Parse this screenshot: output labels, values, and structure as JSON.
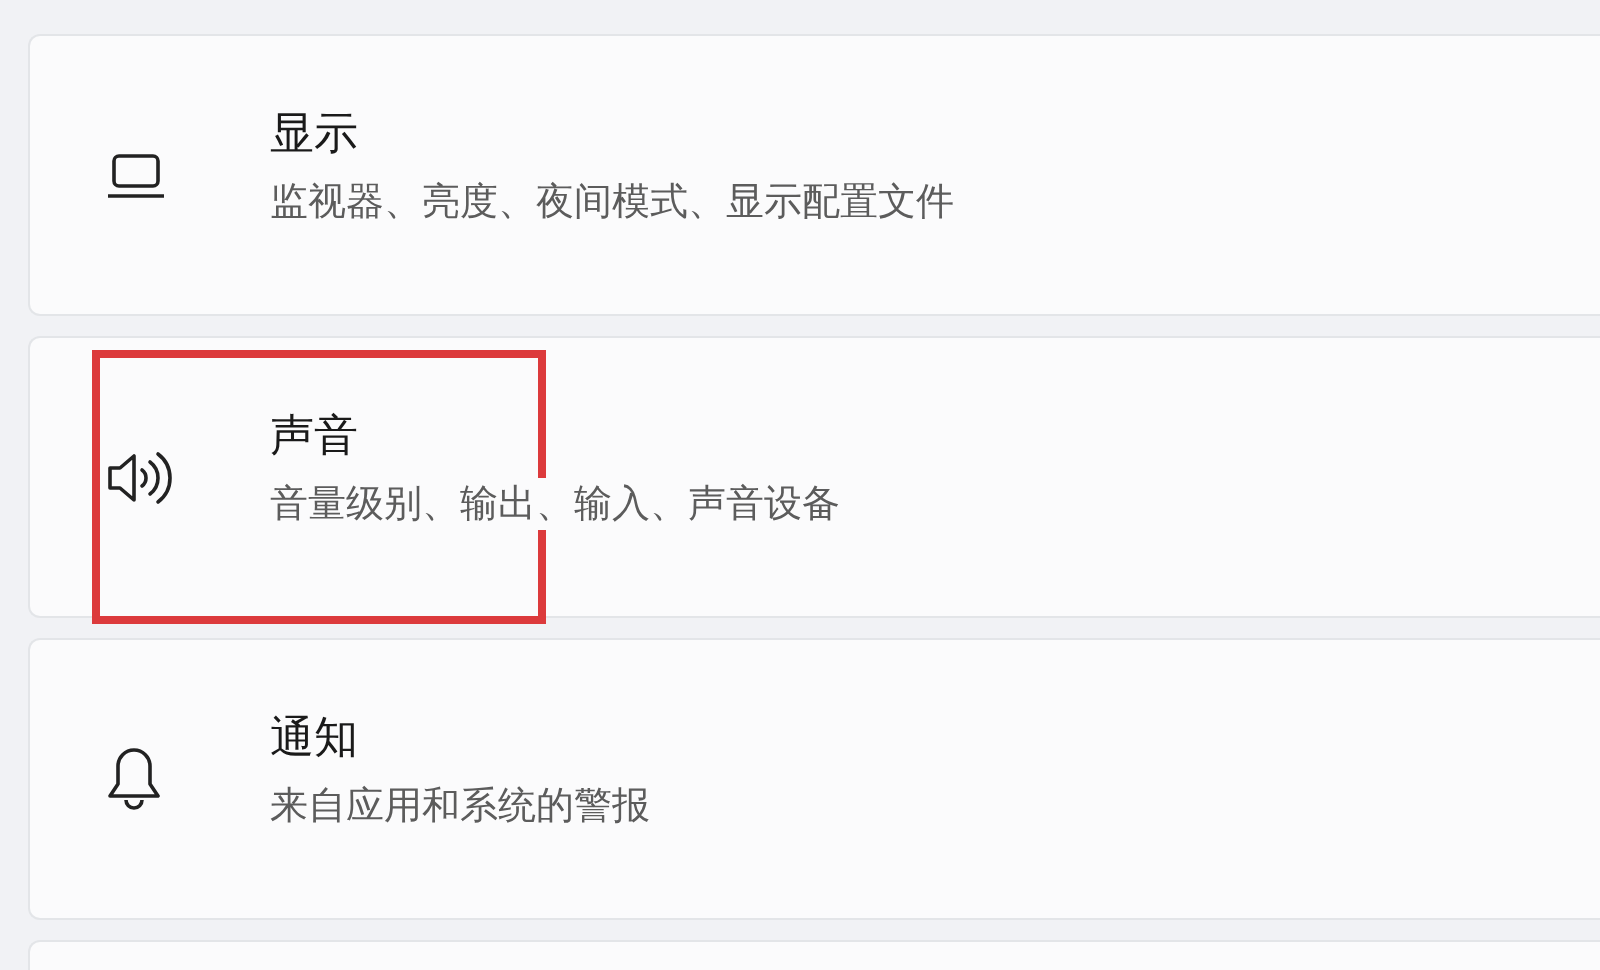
{
  "settings_items": [
    {
      "kind": "display",
      "title": "显示",
      "description": "监视器、亮度、夜间模式、显示配置文件",
      "highlighted": false
    },
    {
      "kind": "sound",
      "title": "声音",
      "description": "音量级别、输出、输入、声音设备",
      "highlighted": true
    },
    {
      "kind": "notifications",
      "title": "通知",
      "description": "来自应用和系统的警报",
      "highlighted": false
    }
  ]
}
